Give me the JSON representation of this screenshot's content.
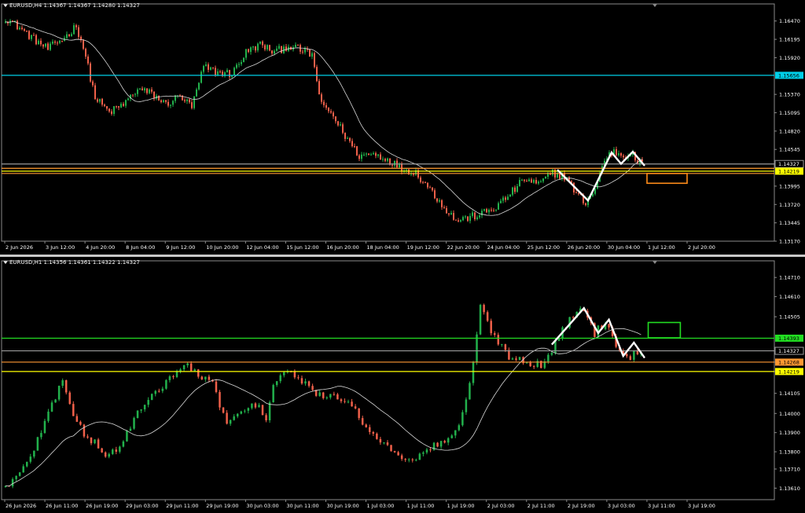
{
  "chart_data": [
    {
      "type": "candlestick",
      "header": "EURUSD,H4  1.14367 1.14367 1.14280 1.14327",
      "y_ticks": [
        "1.16470",
        "1.16195",
        "1.15920",
        "1.15370",
        "1.15095",
        "1.14820",
        "1.14545",
        "1.13995",
        "1.13720",
        "1.13445",
        "1.13170"
      ],
      "y_values": [
        1.1647,
        1.16195,
        1.1592,
        1.1537,
        1.15095,
        1.1482,
        1.14545,
        1.13995,
        1.1372,
        1.13445,
        1.1317
      ],
      "ylim": [
        1.1317,
        1.1662
      ],
      "x_ticks": [
        "2 Jun 2026",
        "3 Jun 12:00",
        "4 Jun 20:00",
        "8 Jun 04:00",
        "9 Jun 12:00",
        "10 Jun 20:00",
        "12 Jun 04:00",
        "15 Jun 12:00",
        "16 Jun 20:00",
        "18 Jun 04:00",
        "19 Jun 12:00",
        "22 Jun 20:00",
        "24 Jun 04:00",
        "25 Jun 12:00",
        "26 Jun 20:00",
        "30 Jun 04:00",
        "1 Jul 12:00",
        "2 Jul 20:00"
      ],
      "hlines": [
        {
          "label": "1.15656",
          "value": 1.15656,
          "color": "#00cfe8"
        },
        {
          "label": "1.14327",
          "value": 1.14327,
          "color": "#9a9a9a"
        },
        {
          "label": "1.14219",
          "value": 1.14219,
          "color": "#ffff00"
        },
        {
          "label": "",
          "value": 1.14262,
          "color": "#ff9933"
        },
        {
          "label": "",
          "value": 1.14185,
          "color": "#ff9933"
        }
      ],
      "anchors": [
        [
          0,
          1.1652
        ],
        [
          6,
          1.1637
        ],
        [
          12,
          1.162
        ],
        [
          18,
          1.1605
        ],
        [
          22,
          1.1615
        ],
        [
          26,
          1.1625
        ],
        [
          30,
          1.164
        ],
        [
          33,
          1.1608
        ],
        [
          38,
          1.1532
        ],
        [
          44,
          1.151
        ],
        [
          50,
          1.1522
        ],
        [
          56,
          1.1545
        ],
        [
          62,
          1.1538
        ],
        [
          68,
          1.1522
        ],
        [
          74,
          1.1535
        ],
        [
          79,
          1.1518
        ],
        [
          84,
          1.1578
        ],
        [
          90,
          1.157
        ],
        [
          96,
          1.1568
        ],
        [
          102,
          1.16
        ],
        [
          108,
          1.1612
        ],
        [
          114,
          1.16
        ],
        [
          120,
          1.161
        ],
        [
          124,
          1.1605
        ],
        [
          130,
          1.1596
        ],
        [
          134,
          1.152
        ],
        [
          138,
          1.151
        ],
        [
          144,
          1.1475
        ],
        [
          150,
          1.1445
        ],
        [
          156,
          1.1448
        ],
        [
          162,
          1.144
        ],
        [
          168,
          1.1426
        ],
        [
          174,
          1.142
        ],
        [
          180,
          1.1395
        ],
        [
          186,
          1.1368
        ],
        [
          191,
          1.1348
        ],
        [
          196,
          1.1352
        ],
        [
          202,
          1.1358
        ],
        [
          208,
          1.1368
        ],
        [
          214,
          1.1388
        ],
        [
          220,
          1.141
        ],
        [
          226,
          1.1402
        ],
        [
          232,
          1.142
        ],
        [
          238,
          1.1412
        ],
        [
          242,
          1.1388
        ],
        [
          246,
          1.1375
        ],
        [
          250,
          1.1395
        ],
        [
          254,
          1.144
        ],
        [
          258,
          1.1452
        ],
        [
          262,
          1.1445
        ],
        [
          265,
          1.145
        ],
        [
          268,
          1.1436
        ],
        [
          270,
          1.1433
        ]
      ],
      "annotations": {
        "zigzag": [
          [
            234,
            1.1424
          ],
          [
            247,
            1.1378
          ],
          [
            257,
            1.145
          ],
          [
            261,
            1.1433
          ],
          [
            266,
            1.1451
          ],
          [
            271,
            1.143
          ]
        ],
        "box": {
          "x0": 272,
          "x1": 289,
          "y0": 1.14185,
          "y1": 1.14038,
          "color": "#ff8c1a"
        }
      }
    },
    {
      "type": "candlestick",
      "header": "EURUSD,H1  1.14356 1.14361 1.14322 1.14327",
      "y_ticks": [
        "1.14710",
        "1.14610",
        "1.14505",
        "1.14327",
        "1.14268",
        "1.14219",
        "1.14105",
        "1.14000",
        "1.13900",
        "1.13800",
        "1.13710",
        "1.13610"
      ],
      "y_values": [
        1.1471,
        1.1461,
        1.14505,
        1.14327,
        1.14268,
        1.14219,
        1.14105,
        1.14,
        1.139,
        1.138,
        1.1371,
        1.1361
      ],
      "ylim": [
        1.1355,
        1.1476
      ],
      "x_ticks": [
        "26 Jun 2026",
        "26 Jun 11:00",
        "26 Jun 19:00",
        "29 Jun 03:00",
        "29 Jun 11:00",
        "29 Jun 19:00",
        "30 Jun 03:00",
        "30 Jun 11:00",
        "30 Jun 19:00",
        "1 Jul 03:00",
        "1 Jul 11:00",
        "1 Jul 19:00",
        "2 Jul 03:00",
        "2 Jul 11:00",
        "2 Jul 19:00",
        "3 Jul 03:00",
        "3 Jul 11:00",
        "3 Jul 19:00"
      ],
      "hlines": [
        {
          "label": "1.14393",
          "value": 1.14393,
          "color": "#22dd22"
        },
        {
          "label": "1.14327",
          "value": 1.14327,
          "color": "#9a9a9a"
        },
        {
          "label": "1.14268",
          "value": 1.14268,
          "color": "#ff9933"
        },
        {
          "label": "1.14219",
          "value": 1.14219,
          "color": "#ffff00"
        }
      ],
      "anchors": [
        [
          0,
          1.1362
        ],
        [
          4,
          1.1368
        ],
        [
          8,
          1.1382
        ],
        [
          12,
          1.14
        ],
        [
          16,
          1.1418
        ],
        [
          19,
          1.14
        ],
        [
          22,
          1.1388
        ],
        [
          25,
          1.1385
        ],
        [
          28,
          1.1378
        ],
        [
          32,
          1.1382
        ],
        [
          36,
          1.1398
        ],
        [
          40,
          1.1406
        ],
        [
          44,
          1.1415
        ],
        [
          48,
          1.1422
        ],
        [
          51,
          1.1425
        ],
        [
          54,
          1.142
        ],
        [
          58,
          1.1415
        ],
        [
          62,
          1.1395
        ],
        [
          66,
          1.14
        ],
        [
          70,
          1.1405
        ],
        [
          73,
          1.1398
        ],
        [
          75,
          1.1415
        ],
        [
          78,
          1.1422
        ],
        [
          82,
          1.1418
        ],
        [
          86,
          1.1412
        ],
        [
          90,
          1.1408
        ],
        [
          95,
          1.1408
        ],
        [
          99,
          1.1398
        ],
        [
          103,
          1.139
        ],
        [
          107,
          1.1382
        ],
        [
          111,
          1.1378
        ],
        [
          115,
          1.1376
        ],
        [
          119,
          1.1382
        ],
        [
          123,
          1.1386
        ],
        [
          127,
          1.1392
        ],
        [
          130,
          1.1415
        ],
        [
          133,
          1.1455
        ],
        [
          137,
          1.144
        ],
        [
          141,
          1.143
        ],
        [
          145,
          1.1428
        ],
        [
          150,
          1.1425
        ],
        [
          154,
          1.1436
        ],
        [
          158,
          1.145
        ],
        [
          162,
          1.1455
        ],
        [
          165,
          1.1442
        ],
        [
          168,
          1.1448
        ],
        [
          171,
          1.1436
        ],
        [
          175,
          1.143
        ],
        [
          178,
          1.1433
        ]
      ],
      "annotations": {
        "zigzag": [
          [
            153,
            1.1436
          ],
          [
            162,
            1.1455
          ],
          [
            166,
            1.1442
          ],
          [
            169,
            1.1449
          ],
          [
            173,
            1.143
          ],
          [
            176,
            1.1437
          ],
          [
            179,
            1.1429
          ]
        ],
        "box": {
          "x0": 180,
          "x1": 189,
          "y0": 1.14475,
          "y1": 1.14395,
          "color": "#22dd22"
        }
      }
    }
  ]
}
